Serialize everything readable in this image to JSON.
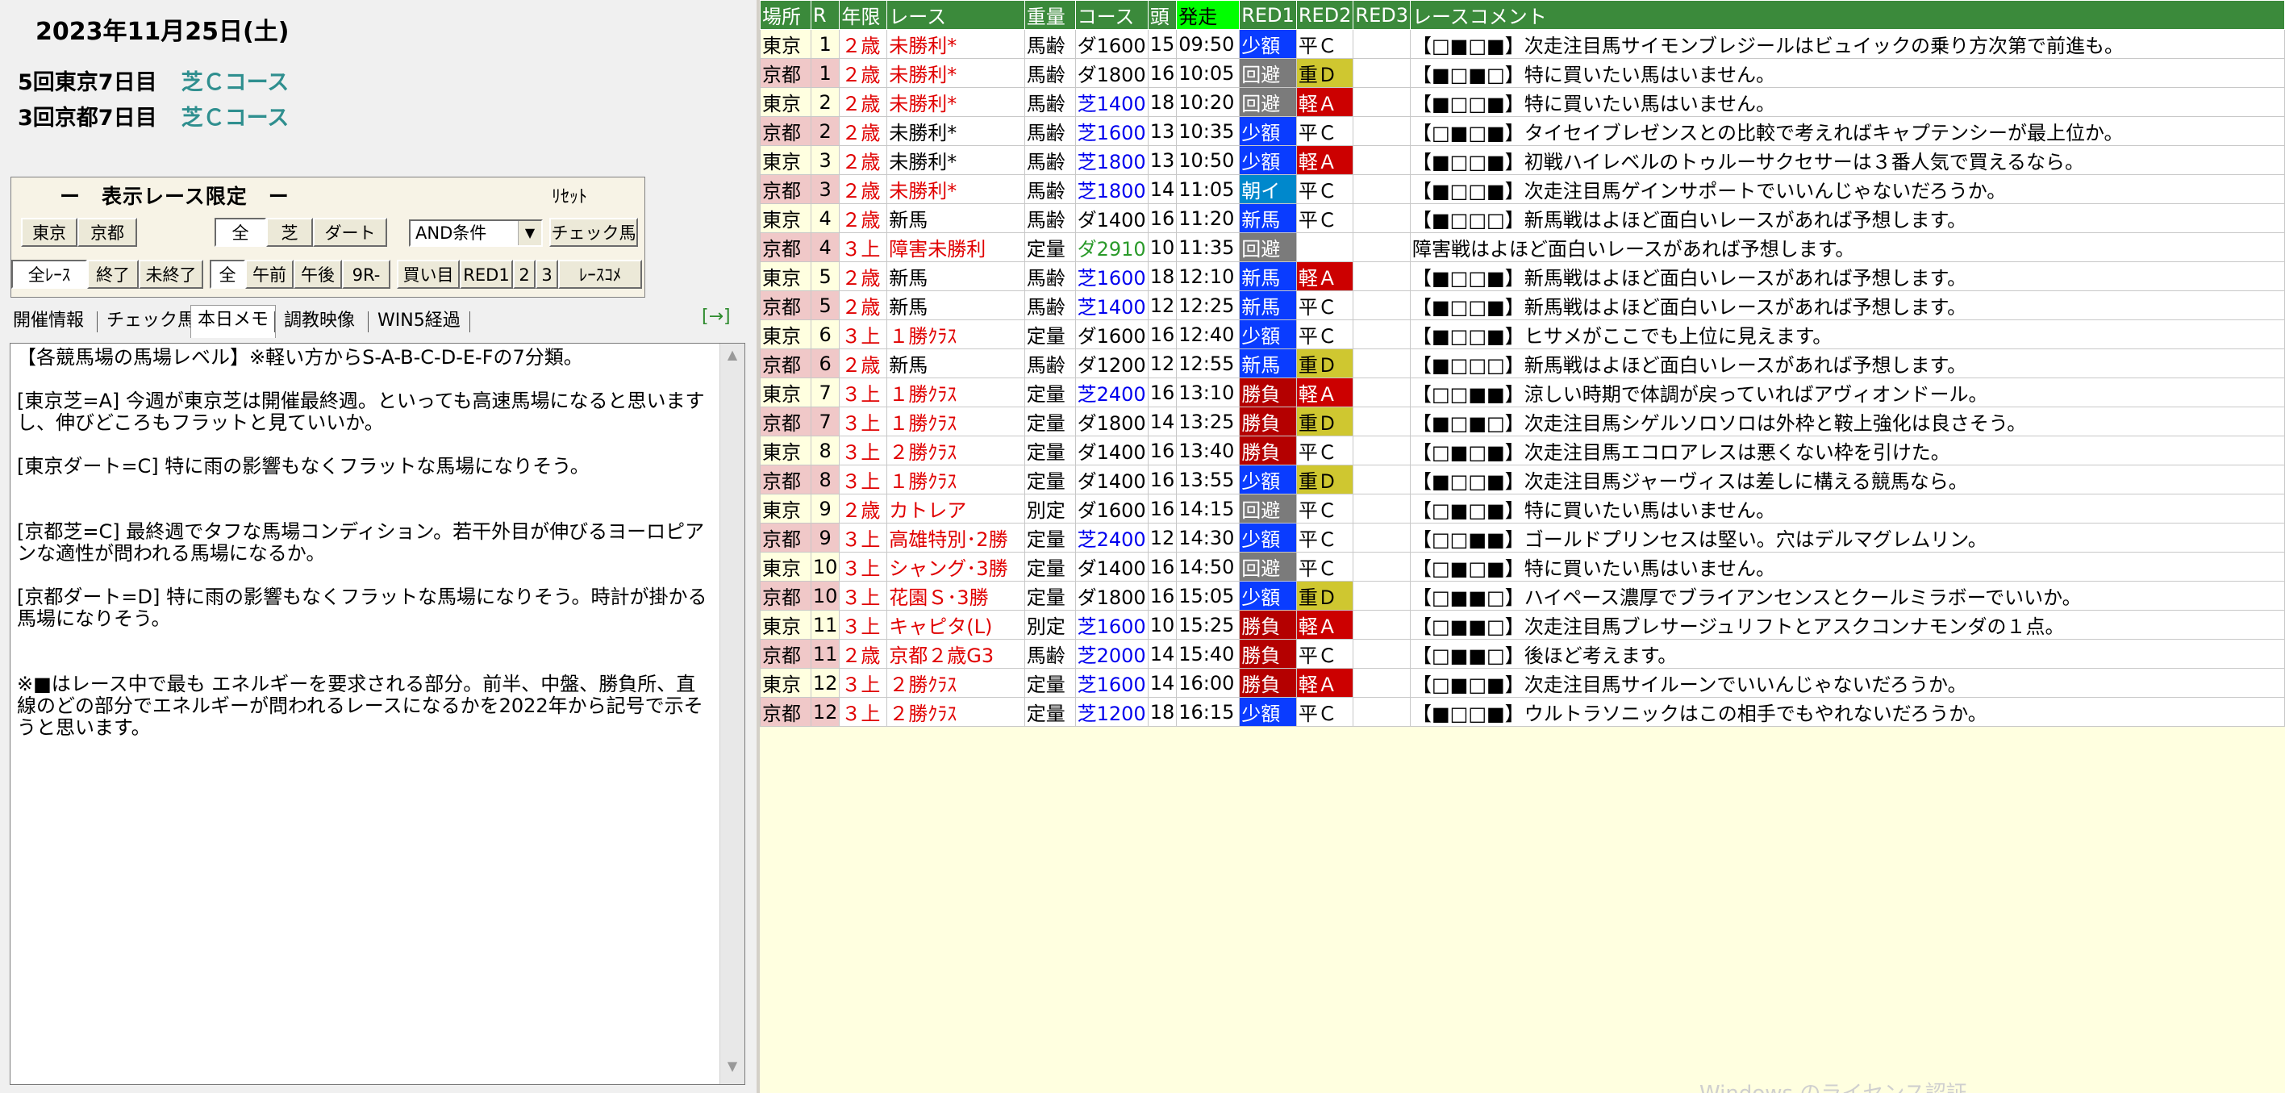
{
  "left": {
    "date": "2023年11月25日(土)",
    "meetings": [
      {
        "name": "5回東京7日目",
        "condition": "芝Ｃコース"
      },
      {
        "name": "3回京都7日目",
        "condition": "芝Ｃコース"
      }
    ],
    "filter": {
      "title": "ー　表示レース限定　ー",
      "reset": "ﾘｾｯﾄ",
      "venue_buttons": [
        "東京",
        "京都"
      ],
      "surface_buttons": [
        "全",
        "芝",
        "ダート"
      ],
      "condition_select": "AND条件",
      "check_button": "チェック馬",
      "status_buttons": [
        "全ﾚｰｽ",
        "終了",
        "未終了"
      ],
      "time_buttons": [
        "全",
        "午前",
        "午後",
        "9R-"
      ],
      "other_buttons": [
        "買い目",
        "RED1",
        "2",
        "3",
        "ﾚｰｽｺﾒ"
      ]
    },
    "tabs": [
      "開催情報",
      "チェック馬",
      "本日メモ",
      "調教映像",
      "WIN5経過"
    ],
    "arrow_link": "[→]",
    "memo": "【各競馬場の馬場レベル】※軽い方からS-A-B-C-D-E-Fの7分類。\n\n[東京芝=A] 今週が東京芝は開催最終週。といっても高速馬場になると思いますし、伸びどころもフラットと見ていいか。\n\n[東京ダート=C] 特に雨の影響もなくフラットな馬場になりそう。\n\n\n[京都芝=C] 最終週でタフな馬場コンディション。若干外目が伸びるヨーロピアンな適性が問われる馬場になるか。\n\n[京都ダート=D] 特に雨の影響もなくフラットな馬場になりそう。時計が掛かる馬場になりそう。\n\n\n※■はレース中で最も エネルギーを要求される部分。前半、中盤、勝負所、直線のどの部分でエネルギーが問われるレースになるかを2022年から記号で示そうと思います。"
  },
  "grid": {
    "headers": [
      "場所",
      "R",
      "年限",
      "レース",
      "重量",
      "コース",
      "頭",
      "発走",
      "RED1",
      "RED2",
      "RED3",
      "レースコメント"
    ],
    "rows": [
      {
        "venue": "東京",
        "r": "1",
        "age": "２歳",
        "cls": "未勝利*",
        "cls_red": true,
        "wt": "馬齢",
        "course": "ダ1600",
        "surf": "dirt",
        "heads": "15",
        "time": "09:50",
        "m1": "少額",
        "m1c": "m-shou",
        "m2": "平Ｃ",
        "m2c": "m-hei",
        "comment": "【□■□■】次走注目馬サイモンブレジールはビュイックの乗り方次第で前進も。"
      },
      {
        "venue": "京都",
        "r": "1",
        "age": "２歳",
        "cls": "未勝利*",
        "cls_red": true,
        "wt": "馬齢",
        "course": "ダ1800",
        "surf": "dirt",
        "heads": "16",
        "time": "10:05",
        "m1": "回避",
        "m1c": "m-kai",
        "m2": "重Ｄ",
        "m2c": "m-jyu",
        "comment": "【■□■□】特に買いたい馬はいません。"
      },
      {
        "venue": "東京",
        "r": "2",
        "age": "２歳",
        "cls": "未勝利*",
        "cls_red": true,
        "wt": "馬齢",
        "course": "芝1400",
        "surf": "turf",
        "heads": "18",
        "time": "10:20",
        "m1": "回避",
        "m1c": "m-kai",
        "m2": "軽Ａ",
        "m2c": "m-kei",
        "comment": "【■□□■】特に買いたい馬はいません。"
      },
      {
        "venue": "京都",
        "r": "2",
        "age": "２歳",
        "cls": "未勝利*",
        "cls_red": false,
        "wt": "馬齢",
        "course": "芝1600",
        "surf": "turf",
        "heads": "13",
        "time": "10:35",
        "m1": "少額",
        "m1c": "m-shou",
        "m2": "平Ｃ",
        "m2c": "m-hei",
        "comment": "【□■□■】タイセイブレゼンスとの比較で考えればキャプテンシーが最上位か。"
      },
      {
        "venue": "東京",
        "r": "3",
        "age": "２歳",
        "cls": "未勝利*",
        "cls_red": false,
        "wt": "馬齢",
        "course": "芝1800",
        "surf": "turf",
        "heads": "13",
        "time": "10:50",
        "m1": "少額",
        "m1c": "m-shou",
        "m2": "軽Ａ",
        "m2c": "m-kei",
        "comment": "【■□□■】初戦ハイレベルのトゥルーサクセサーは３番人気で買えるなら。"
      },
      {
        "venue": "京都",
        "r": "3",
        "age": "２歳",
        "cls": "未勝利*",
        "cls_red": true,
        "wt": "馬齢",
        "course": "芝1800",
        "surf": "turf",
        "heads": "14",
        "time": "11:05",
        "m1": "朝イ",
        "m1c": "m-asa",
        "m2": "平Ｃ",
        "m2c": "m-hei",
        "comment": "【■□□■】次走注目馬ゲインサポートでいいんじゃないだろうか。"
      },
      {
        "venue": "東京",
        "r": "4",
        "age": "２歳",
        "cls": "新馬",
        "cls_red": false,
        "wt": "馬齢",
        "course": "ダ1400",
        "surf": "dirt",
        "heads": "16",
        "time": "11:20",
        "m1": "新馬",
        "m1c": "m-shin",
        "m2": "平Ｃ",
        "m2c": "m-hei",
        "comment": "【■□□□】新馬戦はよほど面白いレースがあれば予想します。"
      },
      {
        "venue": "京都",
        "r": "4",
        "age": "３上",
        "cls": "障害未勝利",
        "cls_red": true,
        "wt": "定量",
        "course": "ダ2910",
        "surf": "jump",
        "heads": "10",
        "time": "11:35",
        "m1": "回避",
        "m1c": "m-kai",
        "m2": "",
        "m2c": "",
        "comment": "障害戦はよほど面白いレースがあれば予想します。"
      },
      {
        "venue": "東京",
        "r": "5",
        "age": "２歳",
        "cls": "新馬",
        "cls_red": false,
        "wt": "馬齢",
        "course": "芝1600",
        "surf": "turf",
        "heads": "18",
        "time": "12:10",
        "m1": "新馬",
        "m1c": "m-shin",
        "m2": "軽Ａ",
        "m2c": "m-kei",
        "comment": "【■□□■】新馬戦はよほど面白いレースがあれば予想します。"
      },
      {
        "venue": "京都",
        "r": "5",
        "age": "２歳",
        "cls": "新馬",
        "cls_red": false,
        "wt": "馬齢",
        "course": "芝1400",
        "surf": "turf",
        "heads": "12",
        "time": "12:25",
        "m1": "新馬",
        "m1c": "m-shin",
        "m2": "平Ｃ",
        "m2c": "m-hei",
        "comment": "【■□□■】新馬戦はよほど面白いレースがあれば予想します。"
      },
      {
        "venue": "東京",
        "r": "6",
        "age": "３上",
        "cls": "１勝ｸﾗｽ",
        "cls_red": true,
        "wt": "定量",
        "course": "ダ1600",
        "surf": "dirt",
        "heads": "16",
        "time": "12:40",
        "m1": "少額",
        "m1c": "m-shou",
        "m2": "平Ｃ",
        "m2c": "m-hei",
        "comment": "【■□□■】ヒサメがここでも上位に見えます。"
      },
      {
        "venue": "京都",
        "r": "6",
        "age": "２歳",
        "cls": "新馬",
        "cls_red": false,
        "wt": "馬齢",
        "course": "ダ1200",
        "surf": "dirt",
        "heads": "12",
        "time": "12:55",
        "m1": "新馬",
        "m1c": "m-shin",
        "m2": "重Ｄ",
        "m2c": "m-jyu",
        "comment": "【■□□□】新馬戦はよほど面白いレースがあれば予想します。"
      },
      {
        "venue": "東京",
        "r": "7",
        "age": "３上",
        "cls": "１勝ｸﾗｽ",
        "cls_red": true,
        "wt": "定量",
        "course": "芝2400",
        "surf": "turf",
        "heads": "16",
        "time": "13:10",
        "m1": "勝負",
        "m1c": "m-shoubu",
        "m2": "軽Ａ",
        "m2c": "m-kei",
        "comment": "【□□■■】涼しい時期で体調が戻っていればアヴィオンドール。"
      },
      {
        "venue": "京都",
        "r": "7",
        "age": "３上",
        "cls": "１勝ｸﾗｽ",
        "cls_red": true,
        "wt": "定量",
        "course": "ダ1800",
        "surf": "dirt",
        "heads": "14",
        "time": "13:25",
        "m1": "勝負",
        "m1c": "m-shoubu",
        "m2": "重Ｄ",
        "m2c": "m-jyu",
        "comment": "【■□■□】次走注目馬シゲルソロソロは外枠と鞍上強化は良さそう。"
      },
      {
        "venue": "東京",
        "r": "8",
        "age": "３上",
        "cls": "２勝ｸﾗｽ",
        "cls_red": true,
        "wt": "定量",
        "course": "ダ1400",
        "surf": "dirt",
        "heads": "16",
        "time": "13:40",
        "m1": "勝負",
        "m1c": "m-shoubu",
        "m2": "平Ｃ",
        "m2c": "m-hei",
        "comment": "【□■□■】次走注目馬エコロアレスは悪くない枠を引けた。"
      },
      {
        "venue": "京都",
        "r": "8",
        "age": "３上",
        "cls": "１勝ｸﾗｽ",
        "cls_red": true,
        "wt": "定量",
        "course": "ダ1400",
        "surf": "dirt",
        "heads": "16",
        "time": "13:55",
        "m1": "少額",
        "m1c": "m-shou",
        "m2": "重Ｄ",
        "m2c": "m-jyu",
        "comment": "【■□□■】次走注目馬ジャーヴィスは差しに構える競馬なら。"
      },
      {
        "venue": "東京",
        "r": "9",
        "age": "２歳",
        "cls": "カトレア",
        "cls_red": true,
        "wt": "別定",
        "course": "ダ1600",
        "surf": "dirt",
        "heads": "16",
        "time": "14:15",
        "m1": "回避",
        "m1c": "m-kai",
        "m2": "平Ｃ",
        "m2c": "m-hei",
        "comment": "【□■□■】特に買いたい馬はいません。"
      },
      {
        "venue": "京都",
        "r": "9",
        "age": "３上",
        "cls": "高雄特別･2勝",
        "cls_red": true,
        "wt": "定量",
        "course": "芝2400",
        "surf": "turf",
        "heads": "12",
        "time": "14:30",
        "m1": "少額",
        "m1c": "m-shou",
        "m2": "平Ｃ",
        "m2c": "m-hei",
        "comment": "【□□■■】ゴールドプリンセスは堅い。穴はデルマグレムリン。"
      },
      {
        "venue": "東京",
        "r": "10",
        "age": "３上",
        "cls": "シャング･3勝",
        "cls_red": true,
        "wt": "定量",
        "course": "ダ1400",
        "surf": "dirt",
        "heads": "16",
        "time": "14:50",
        "m1": "回避",
        "m1c": "m-kai",
        "m2": "平Ｃ",
        "m2c": "m-hei",
        "comment": "【□■□■】特に買いたい馬はいません。"
      },
      {
        "venue": "京都",
        "r": "10",
        "age": "３上",
        "cls": "花園Ｓ･3勝",
        "cls_red": true,
        "wt": "定量",
        "course": "ダ1800",
        "surf": "dirt",
        "heads": "16",
        "time": "15:05",
        "m1": "少額",
        "m1c": "m-shou",
        "m2": "重Ｄ",
        "m2c": "m-jyu",
        "comment": "【□■■□】ハイペース濃厚でブライアンセンスとクールミラボーでいいか。"
      },
      {
        "venue": "東京",
        "r": "11",
        "age": "３上",
        "cls": "キャピタ(L)",
        "cls_red": true,
        "wt": "別定",
        "course": "芝1600",
        "surf": "turf",
        "heads": "10",
        "time": "15:25",
        "m1": "勝負",
        "m1c": "m-shoubu",
        "m2": "軽Ａ",
        "m2c": "m-kei",
        "comment": "【□■■□】次走注目馬ブレサージュリフトとアスクコンナモンダの１点。"
      },
      {
        "venue": "京都",
        "r": "11",
        "age": "２歳",
        "cls": "京都２歳G3",
        "cls_red": true,
        "wt": "馬齢",
        "course": "芝2000",
        "surf": "turf",
        "heads": "14",
        "time": "15:40",
        "m1": "勝負",
        "m1c": "m-shoubu",
        "m2": "平Ｃ",
        "m2c": "m-hei",
        "comment": "【□■■□】後ほど考えます。"
      },
      {
        "venue": "東京",
        "r": "12",
        "age": "３上",
        "cls": "２勝ｸﾗｽ",
        "cls_red": true,
        "wt": "定量",
        "course": "芝1600",
        "surf": "turf",
        "heads": "14",
        "time": "16:00",
        "m1": "勝負",
        "m1c": "m-shoubu",
        "m2": "軽Ａ",
        "m2c": "m-kei",
        "comment": "【□■□■】次走注目馬サイルーンでいいんじゃないだろうか。"
      },
      {
        "venue": "京都",
        "r": "12",
        "age": "３上",
        "cls": "２勝ｸﾗｽ",
        "cls_red": true,
        "wt": "定量",
        "course": "芝1200",
        "surf": "turf",
        "heads": "18",
        "time": "16:15",
        "m1": "少額",
        "m1c": "m-shou",
        "m2": "平Ｃ",
        "m2c": "m-hei",
        "comment": "【■□□■】ウルトラソニックはこの相手でもやれないだろうか。"
      }
    ]
  },
  "watermark": "Windows のライセンス認証"
}
